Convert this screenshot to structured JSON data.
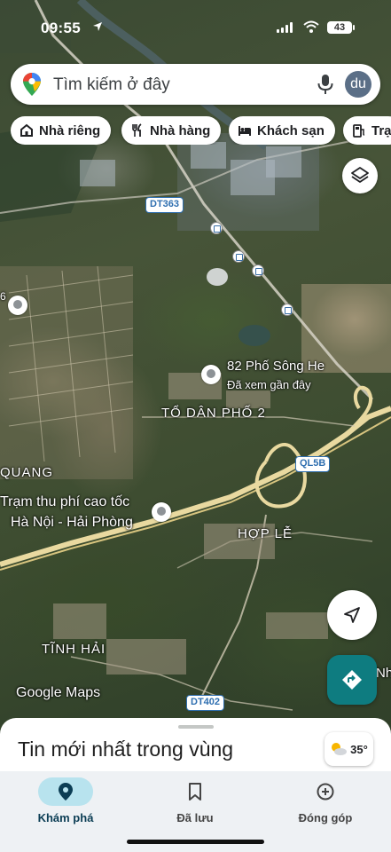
{
  "status_bar": {
    "time": "09:55",
    "battery": "43"
  },
  "search": {
    "placeholder": "Tìm kiếm ở đây",
    "avatar_initials": "du"
  },
  "chips": [
    {
      "label": "Nhà riêng",
      "icon": "home-icon"
    },
    {
      "label": "Nhà hàng",
      "icon": "restaurant-icon"
    },
    {
      "label": "Khách sạn",
      "icon": "hotel-icon"
    },
    {
      "label": "Trạ",
      "icon": "gas-station-icon"
    }
  ],
  "map": {
    "area_labels": [
      "TỔ DÂN PHỐ 2",
      "QUANG",
      "HỢP LỄ",
      "TĨNH HẢI",
      "Nh",
      "6"
    ],
    "road_shields": [
      "DT363",
      "QL5B",
      "DT402"
    ],
    "places": [
      {
        "name": "82 Phố Sông He",
        "note": "Đã xem gần đây"
      },
      {
        "name_line1": "Trạm thu phí cao tốc",
        "name_line2": "Hà Nội - Hải Phòng"
      }
    ],
    "attribution": "Google Maps"
  },
  "sheet": {
    "title": "Tin mới nhất trong vùng",
    "temperature": "35°"
  },
  "nav": {
    "items": [
      {
        "label": "Khám phá",
        "icon": "explore-pin-icon",
        "active": true
      },
      {
        "label": "Đã lưu",
        "icon": "bookmark-icon",
        "active": false
      },
      {
        "label": "Đóng góp",
        "icon": "add-circle-icon",
        "active": false
      }
    ]
  },
  "colors": {
    "accent": "#0e7c80",
    "nav_active_pill": "#b8e3ee",
    "shield_blue": "#2f6fb0",
    "highway": "#e9d9a0"
  }
}
